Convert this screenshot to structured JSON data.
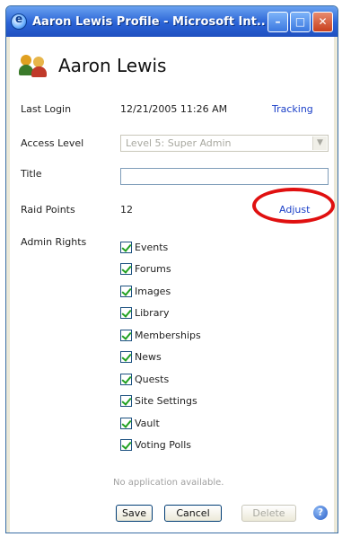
{
  "window": {
    "title": "Aaron Lewis Profile - Microsoft Int...",
    "buttons": [
      "minimize-icon",
      "maximize-icon",
      "close-icon"
    ]
  },
  "profile": {
    "name": "Aaron Lewis",
    "icon": "users-icon"
  },
  "fields": {
    "last_login_label": "Last Login",
    "last_login_value": "12/21/2005 11:26 AM",
    "tracking_link": "Tracking",
    "access_level_label": "Access Level",
    "access_level_value": "Level 5: Super Admin",
    "title_label": "Title",
    "title_value": "",
    "raid_points_label": "Raid Points",
    "raid_points_value": "12",
    "adjust_link": "Adjust",
    "admin_rights_label": "Admin Rights"
  },
  "admin_rights": [
    {
      "label": "Events",
      "checked": true
    },
    {
      "label": "Forums",
      "checked": true
    },
    {
      "label": "Images",
      "checked": true
    },
    {
      "label": "Library",
      "checked": true
    },
    {
      "label": "Memberships",
      "checked": true
    },
    {
      "label": "News",
      "checked": true
    },
    {
      "label": "Quests",
      "checked": true
    },
    {
      "label": "Site Settings",
      "checked": true
    },
    {
      "label": "Vault",
      "checked": true
    },
    {
      "label": "Voting Polls",
      "checked": true
    }
  ],
  "footer": {
    "no_application": "No application available.",
    "save": "Save",
    "cancel": "Cancel",
    "delete": "Delete",
    "help_icon": "help-icon"
  },
  "colors": {
    "link": "#1a3fc8",
    "highlight_oval": "#e01010",
    "titlebar": "#2a63d6"
  }
}
